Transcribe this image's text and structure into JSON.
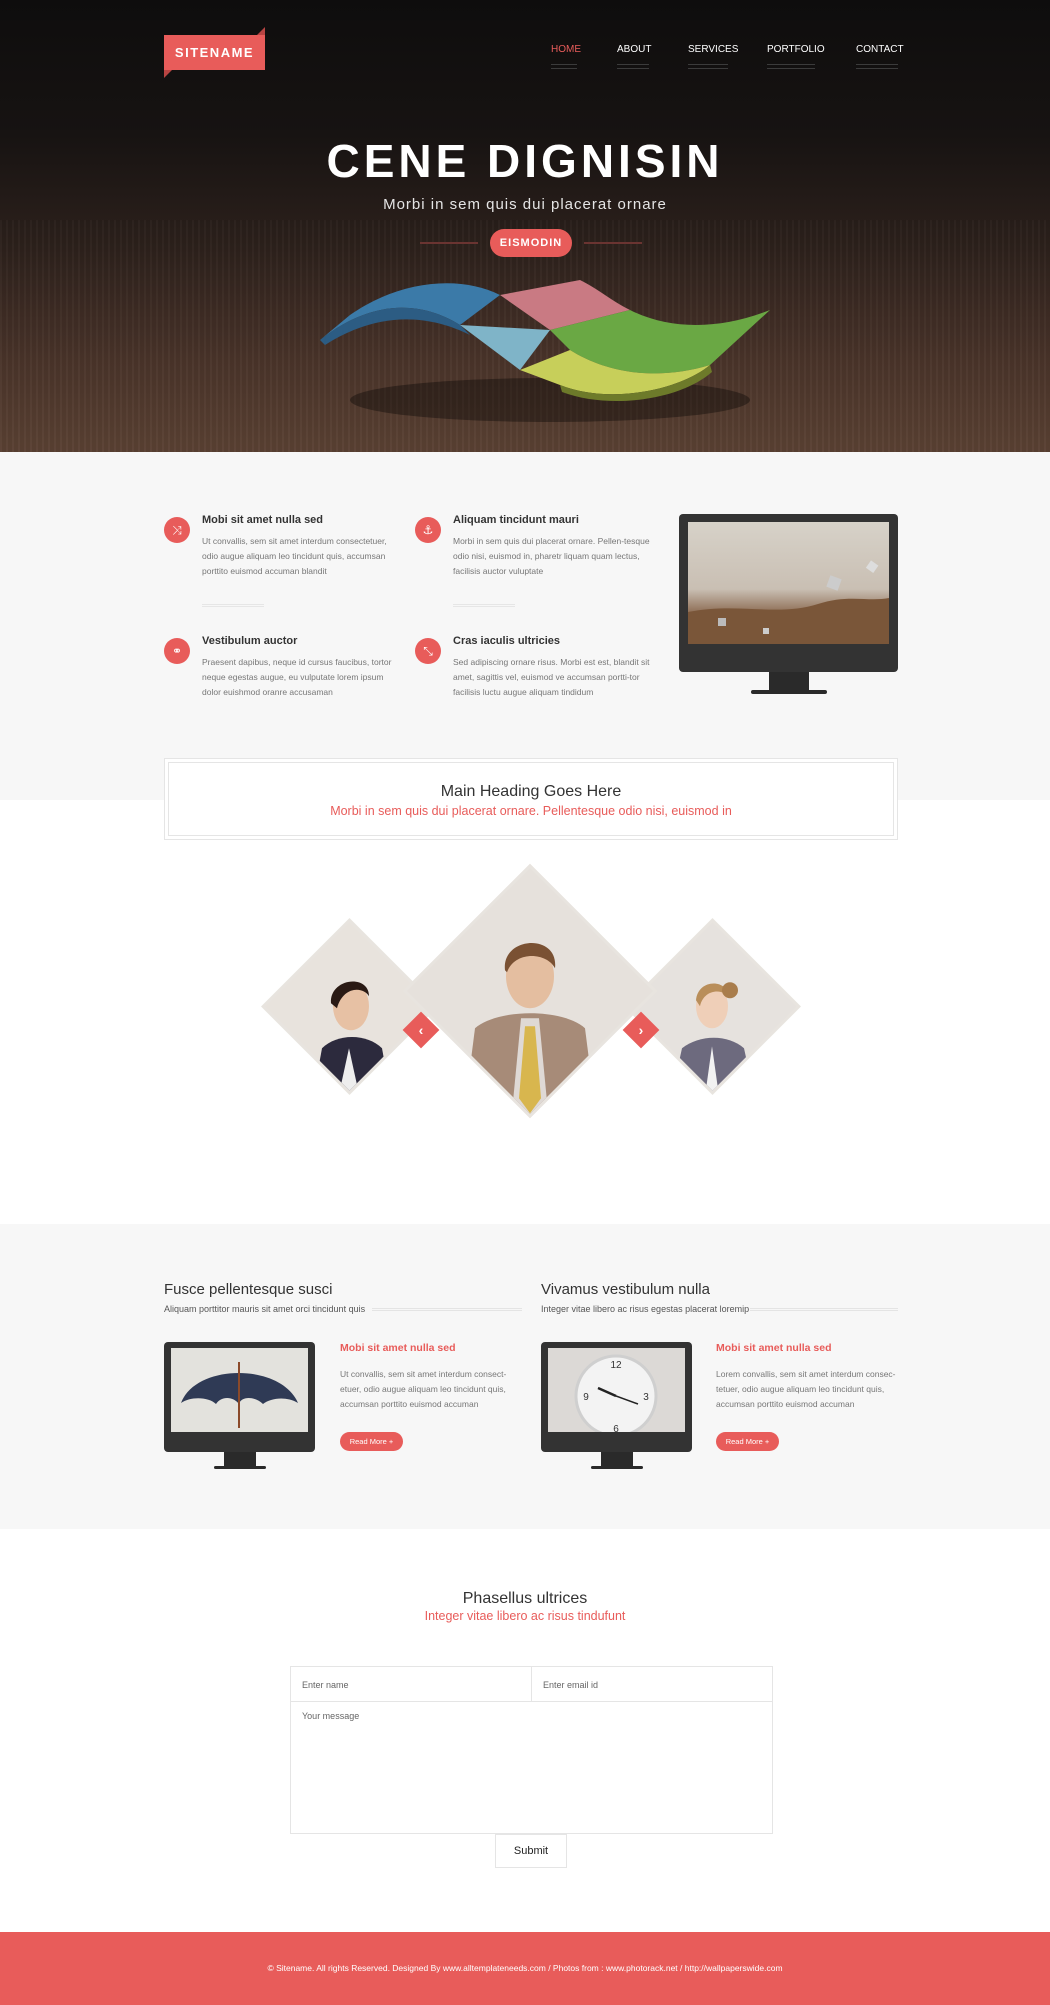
{
  "header": {
    "logo_text": "SITENAME",
    "nav": [
      {
        "label": "HOME",
        "active": true
      },
      {
        "label": "ABOUT",
        "active": false
      },
      {
        "label": "SERVICES",
        "active": false
      },
      {
        "label": "PORTFOLIO",
        "active": false
      },
      {
        "label": "CONTACT",
        "active": false
      }
    ]
  },
  "hero": {
    "title": "CENE DIGNISIN",
    "subtitle": "Morbi in sem quis dui placerat ornare",
    "button_label": "EISMODIN"
  },
  "features": [
    {
      "icon": "shuffle-icon",
      "title": "Mobi sit amet nulla sed",
      "text": "Ut convallis, sem sit amet interdum consectetuer, odio augue aliquam leo  tincidunt quis, accumsan porttito euismod accuman blandit"
    },
    {
      "icon": "anchor-icon",
      "title": "Aliquam tincidunt mauri",
      "text": "Morbi in sem quis dui placerat ornare. Pellen-tesque odio nisi, euismod in, pharetr liquam quam lectus, facilisis auctor vuluptate"
    },
    {
      "icon": "link-icon",
      "title": "Vestibulum auctor",
      "text": "Praesent dapibus, neque id cursus faucibus, tortor neque egestas augue, eu vulputate lorem ipsum dolor euishmod oranre accusaman"
    },
    {
      "icon": "compress-icon",
      "title": "Cras iaculis ultricies",
      "text": "Sed adipiscing ornare risus. Morbi est est, blandit sit amet, sagittis vel, euismod ve  accumsan portti-tor  facilisis luctu augue aliquam tindidum"
    }
  ],
  "heading_box": {
    "title": "Main Heading Goes Here",
    "subtitle": "Morbi in sem quis dui placerat ornare. Pellentesque odio nisi, euismod in"
  },
  "team": {
    "prev_icon": "chevron-left-icon",
    "next_icon": "chevron-right-icon"
  },
  "posts": [
    {
      "heading": "Fusce pellentesque susci",
      "subheading": "Aliquam porttitor mauris sit amet orci tincidunt quis",
      "title": "Mobi sit amet nulla sed",
      "text": "Ut convallis, sem sit amet interdum consect-etuer, odio augue aliquam leo  tincidunt quis, accumsan porttito euismod accuman",
      "button": "Read More +",
      "image": "umbrella"
    },
    {
      "heading": "Vivamus vestibulum nulla",
      "subheading": "Integer vitae libero ac risus egestas placerat loremip",
      "title": "Mobi sit amet nulla sed",
      "text": "Lorem convallis, sem sit amet interdum consec-tetuer, odio augue aliquam leo  tincidunt quis, accumsan porttito euismod accuman",
      "button": "Read More +",
      "image": "clock"
    }
  ],
  "contact": {
    "title": "Phasellus ultrices",
    "subtitle": "Integer vitae libero ac risus tindufunt",
    "name_placeholder": "Enter name",
    "email_placeholder": "Enter email id",
    "message_placeholder": "Your message",
    "submit_label": "Submit"
  },
  "footer": {
    "text": "© Sitename. All rights Reserved. Designed By www.alltemplateneeds.com  /  Photos from : www.photorack.net  /  http://wallpaperswide.com"
  },
  "colors": {
    "accent": "#e85c5a",
    "dark": "#111111",
    "light_bg": "#f7f7f7"
  }
}
